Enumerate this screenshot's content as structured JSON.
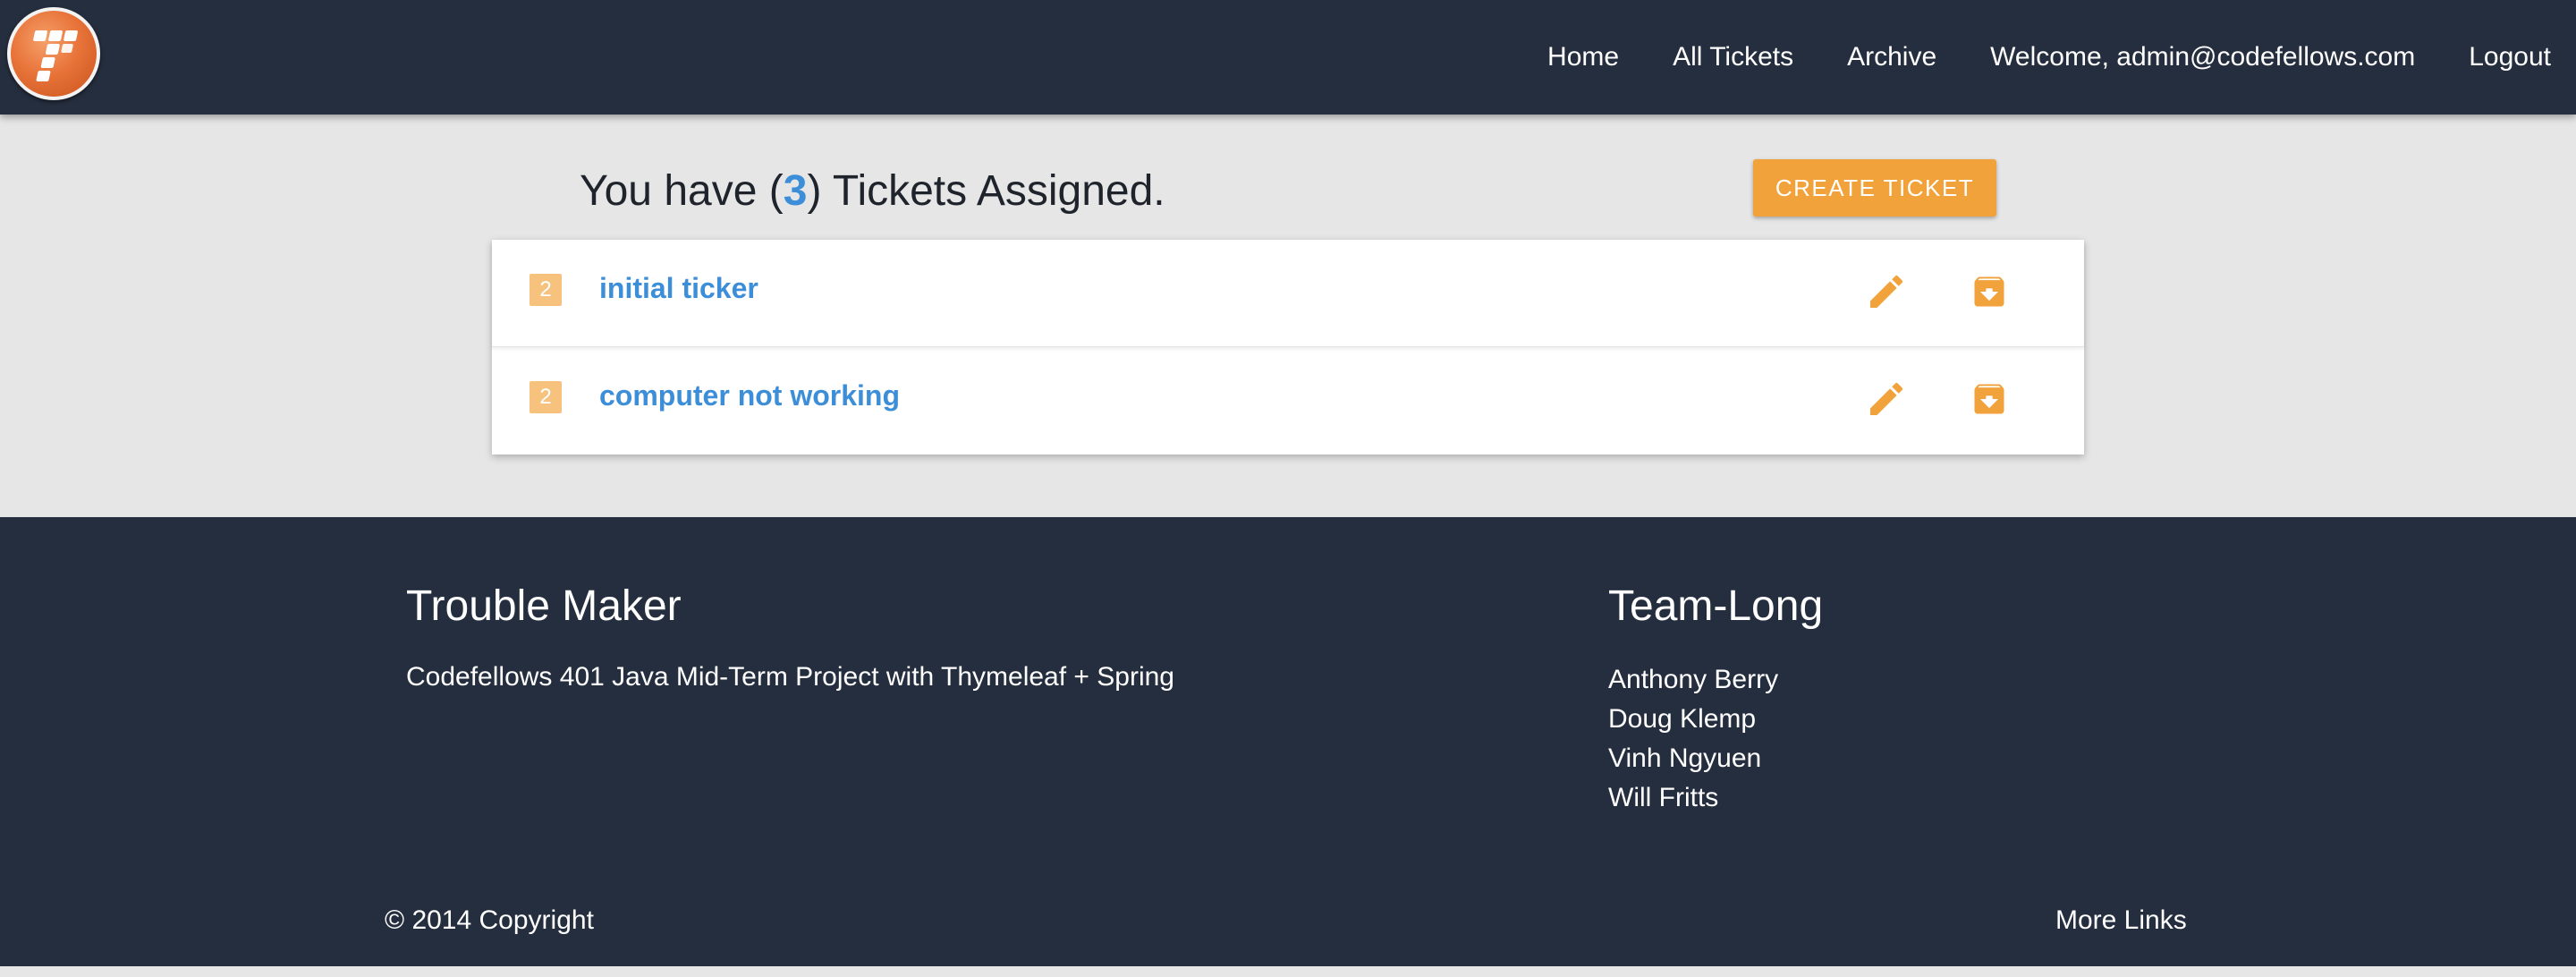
{
  "nav": {
    "logo": "trouble-maker-logo",
    "links": {
      "home": "Home",
      "all_tickets": "All Tickets",
      "archive": "Archive",
      "welcome": "Welcome, admin@codefellows.com",
      "logout": "Logout"
    }
  },
  "main": {
    "heading_prefix": "You have (",
    "ticket_count": "3",
    "heading_suffix": ") Tickets Assigned.",
    "create_button": "CREATE TICKET",
    "tickets": [
      {
        "badge": "2",
        "title": "initial ticker",
        "edit_icon": "pencil-icon",
        "archive_icon": "archive-icon"
      },
      {
        "badge": "2",
        "title": "computer not working",
        "edit_icon": "pencil-icon",
        "archive_icon": "archive-icon"
      }
    ]
  },
  "footer": {
    "project_title": "Trouble Maker",
    "project_description": "Codefellows 401 Java Mid-Term Project with Thymeleaf + Spring",
    "team_title": "Team-Long",
    "members": [
      "Anthony Berry",
      "Doug Klemp",
      "Vinh Ngyuen",
      "Will Fritts"
    ],
    "copyright": "© 2014 Copyright",
    "more_links": "More Links"
  },
  "colors": {
    "nav_bg": "#252e3e",
    "page_bg": "#e6e6e6",
    "accent_orange": "#f2a23a",
    "link_blue": "#3d8ed8",
    "badge_bg": "#f7c27e"
  }
}
